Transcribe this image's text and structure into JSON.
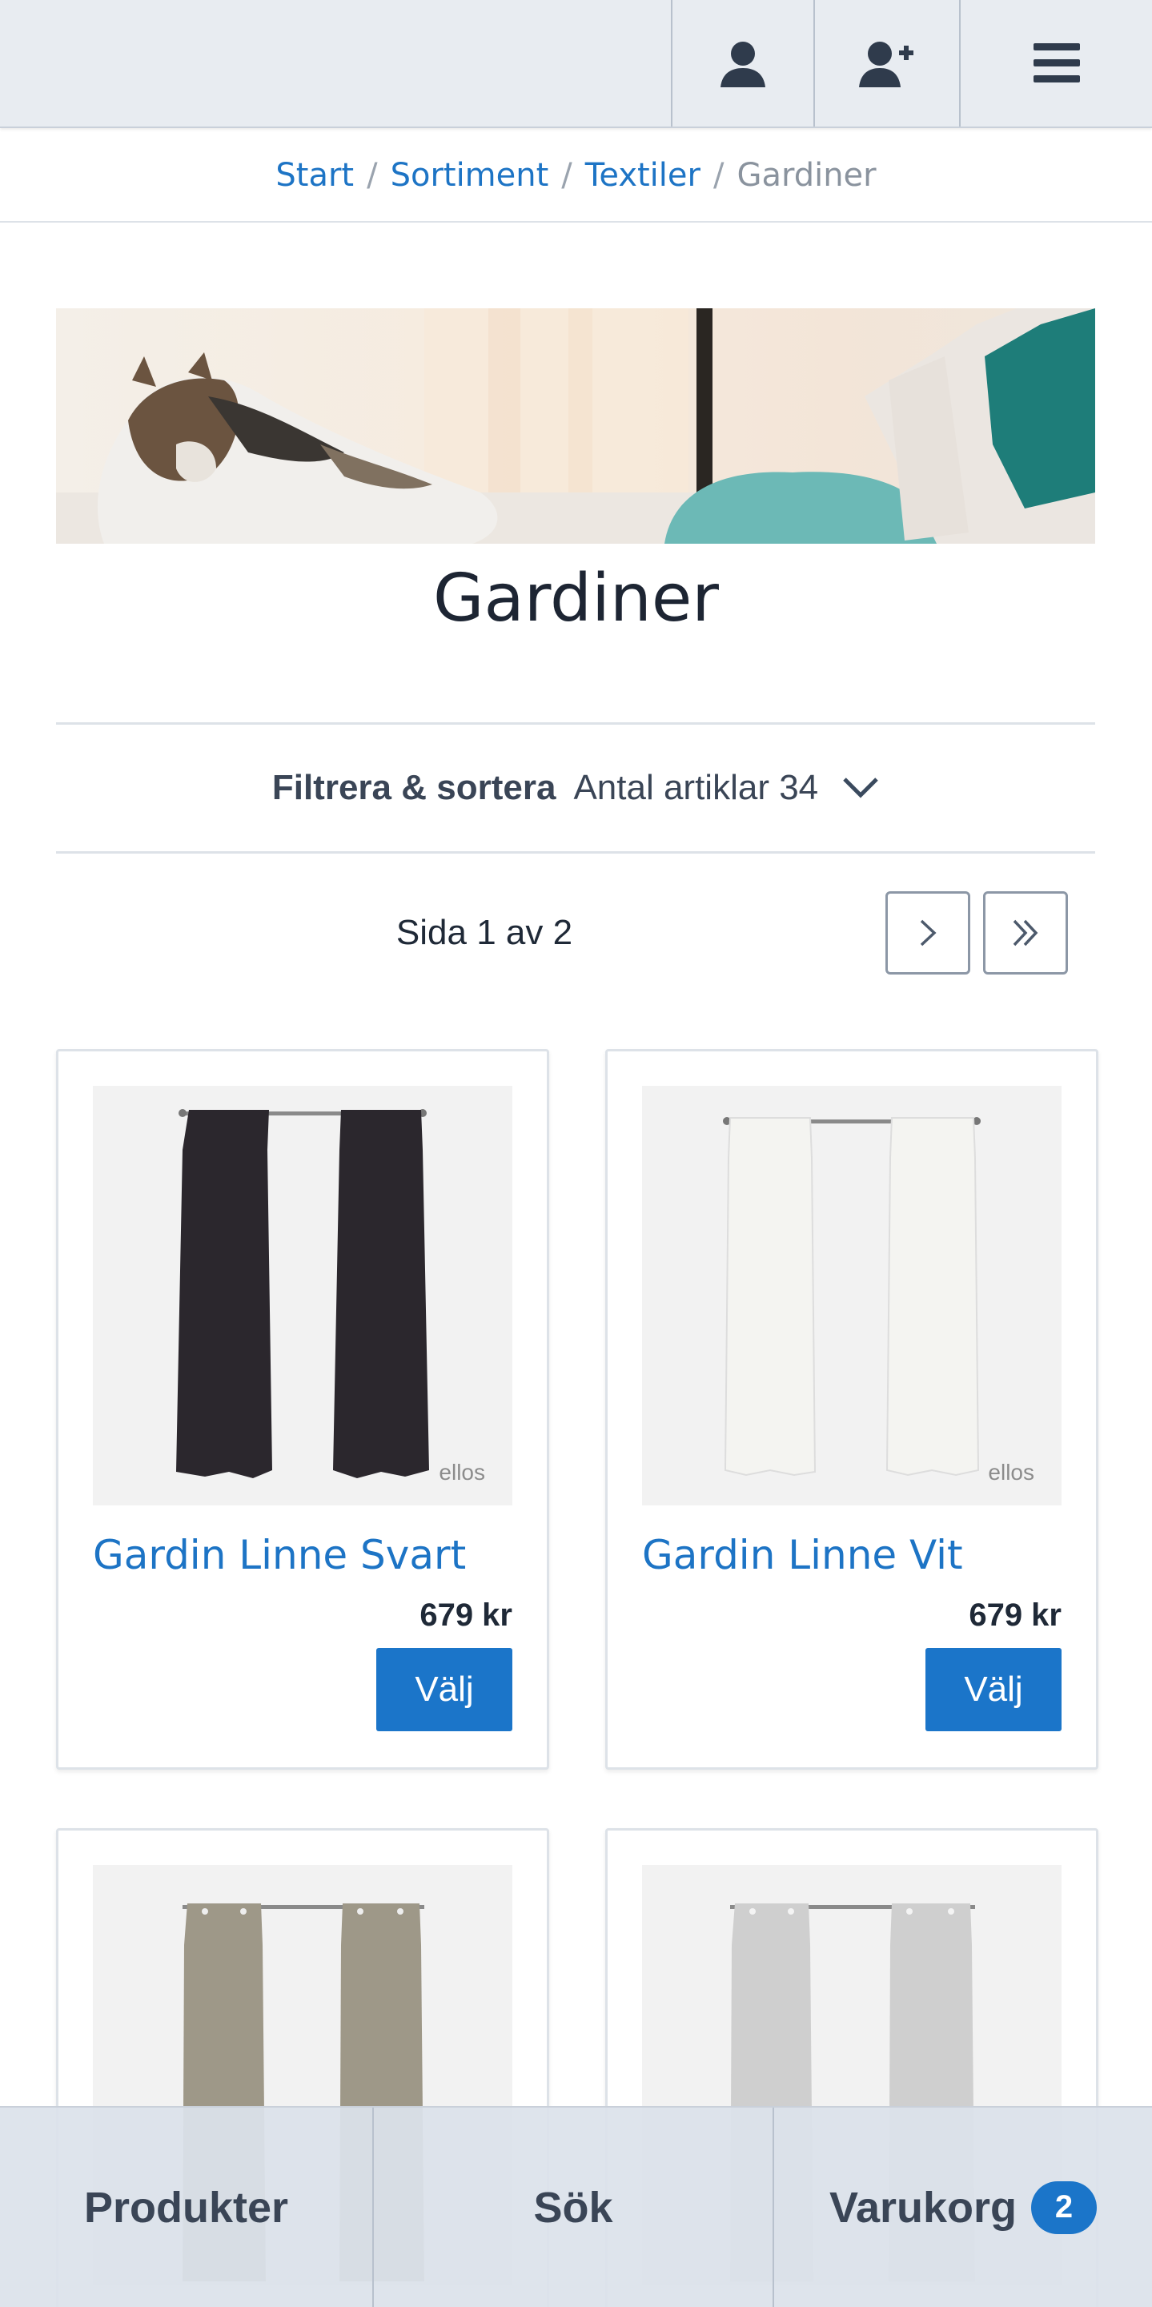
{
  "breadcrumb": {
    "items": [
      "Start",
      "Sortiment",
      "Textiler"
    ],
    "separator": "/",
    "current": "Gardiner"
  },
  "page": {
    "title": "Gardiner"
  },
  "filter": {
    "label": "Filtrera & sortera",
    "count_text": "Antal artiklar 34"
  },
  "pagination": {
    "text": "Sida 1 av 2"
  },
  "products": [
    {
      "name": "Gardin Linne Svart",
      "price": "679 kr",
      "button": "Välj",
      "curtain_color": "#2b272d",
      "brand": "ellos"
    },
    {
      "name": "Gardin Linne Vit",
      "price": "679 kr",
      "button": "Välj",
      "curtain_color": "#f4f4f1",
      "brand": "ellos"
    },
    {
      "name": "",
      "price": "",
      "button": "",
      "curtain_color": "#9e9888",
      "brand": ""
    },
    {
      "name": "",
      "price": "",
      "button": "",
      "curtain_color": "#cfcfcf",
      "brand": ""
    }
  ],
  "bottom_nav": {
    "products": "Produkter",
    "search": "Sök",
    "cart": "Varukorg",
    "cart_count": "2"
  },
  "colors": {
    "accent": "#1b75c9",
    "link": "#1d74c5",
    "header_bg": "#e8ecf1"
  },
  "icons": {
    "header": [
      "user-icon",
      "user-add-icon",
      "menu-icon"
    ],
    "pagination": [
      "chevron-right-icon",
      "double-chevron-right-icon"
    ],
    "filter": "chevron-down-icon"
  }
}
